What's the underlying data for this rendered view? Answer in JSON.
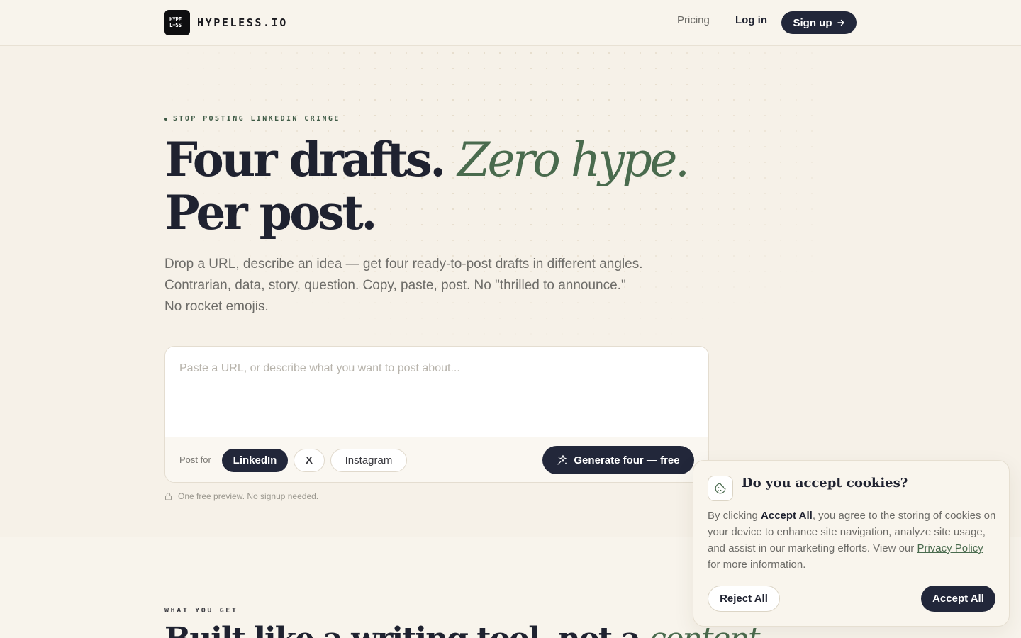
{
  "header": {
    "logo_mark_line1": "HYPE",
    "logo_mark_line2": "L=SS",
    "brand": "HYPELESS.IO",
    "nav_pricing": "Pricing",
    "nav_login": "Log in",
    "nav_signup": "Sign up",
    "signup_icon": "arrow-right-icon"
  },
  "hero": {
    "eyebrow": "STOP POSTING LINKEDIN CRINGE",
    "headline_part1": "Four drafts.",
    "headline_accent": "Zero hype.",
    "headline_part2": "Per post.",
    "subhead": "Drop a URL, describe an idea — get four ready-to-post drafts in different angles. Contrarian, data, story, question. Copy, paste, post. No \"thrilled to announce.\" No rocket emojis."
  },
  "composer": {
    "placeholder": "Paste a URL, or describe what you want to post about...",
    "value": "",
    "post_for_label": "Post for",
    "platforms": [
      {
        "label": "LinkedIn",
        "selected": true
      },
      {
        "label": "X",
        "selected": false
      },
      {
        "label": "Instagram",
        "selected": false
      }
    ],
    "generate_label": "Generate four — free",
    "generate_icon": "sparkle-icon",
    "note": "One free preview. No signup needed.",
    "note_icon": "lock-icon"
  },
  "section": {
    "label": "WHAT YOU GET",
    "title_part1": "Built like a writing tool, not a",
    "title_accent": "content"
  },
  "cookie": {
    "icon": "cookie-icon",
    "title": "Do you accept cookies?",
    "body_prefix": "By clicking",
    "body_bold": "Accept All",
    "body_middle": ", you agree to the storing of cookies on your device to enhance site navigation, analyze site usage, and assist in our marketing efforts. View our",
    "body_link": "Privacy Policy",
    "body_suffix": "for more information.",
    "reject_label": "Reject All",
    "accept_label": "Accept All"
  },
  "colors": {
    "background": "#f6f1e8",
    "ink": "#1f2230",
    "accent_green": "#4a6b4e",
    "muted": "#6d6c68"
  }
}
